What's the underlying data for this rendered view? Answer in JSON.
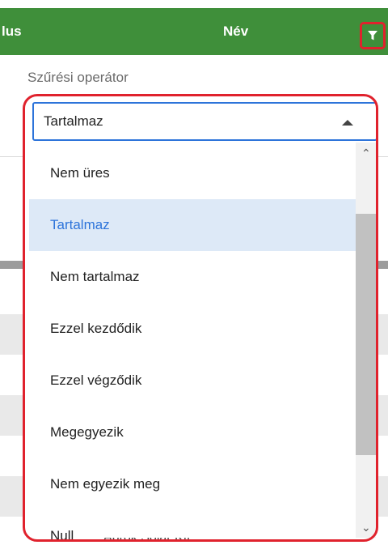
{
  "header": {
    "partial_column_label": "lus",
    "name_column_label": "Név",
    "filter_icon": "filter-icon"
  },
  "filter": {
    "label": "Szűrési operátor",
    "selected_value": "Tartalmaz",
    "options": [
      "Nem üres",
      "Tartalmaz",
      "Nem tartalmaz",
      "Ezzel kezdődik",
      "Ezzel végződik",
      "Megegyezik",
      "Nem egyezik meg",
      "Null"
    ],
    "selected_index": 1
  },
  "background_row": {
    "partial_text": "Ábrók Solar Kft."
  },
  "colors": {
    "header_green": "#3f8f3a",
    "highlight_red": "#e0222d",
    "focus_blue": "#2d74da",
    "selected_bg": "#dde9f7"
  }
}
